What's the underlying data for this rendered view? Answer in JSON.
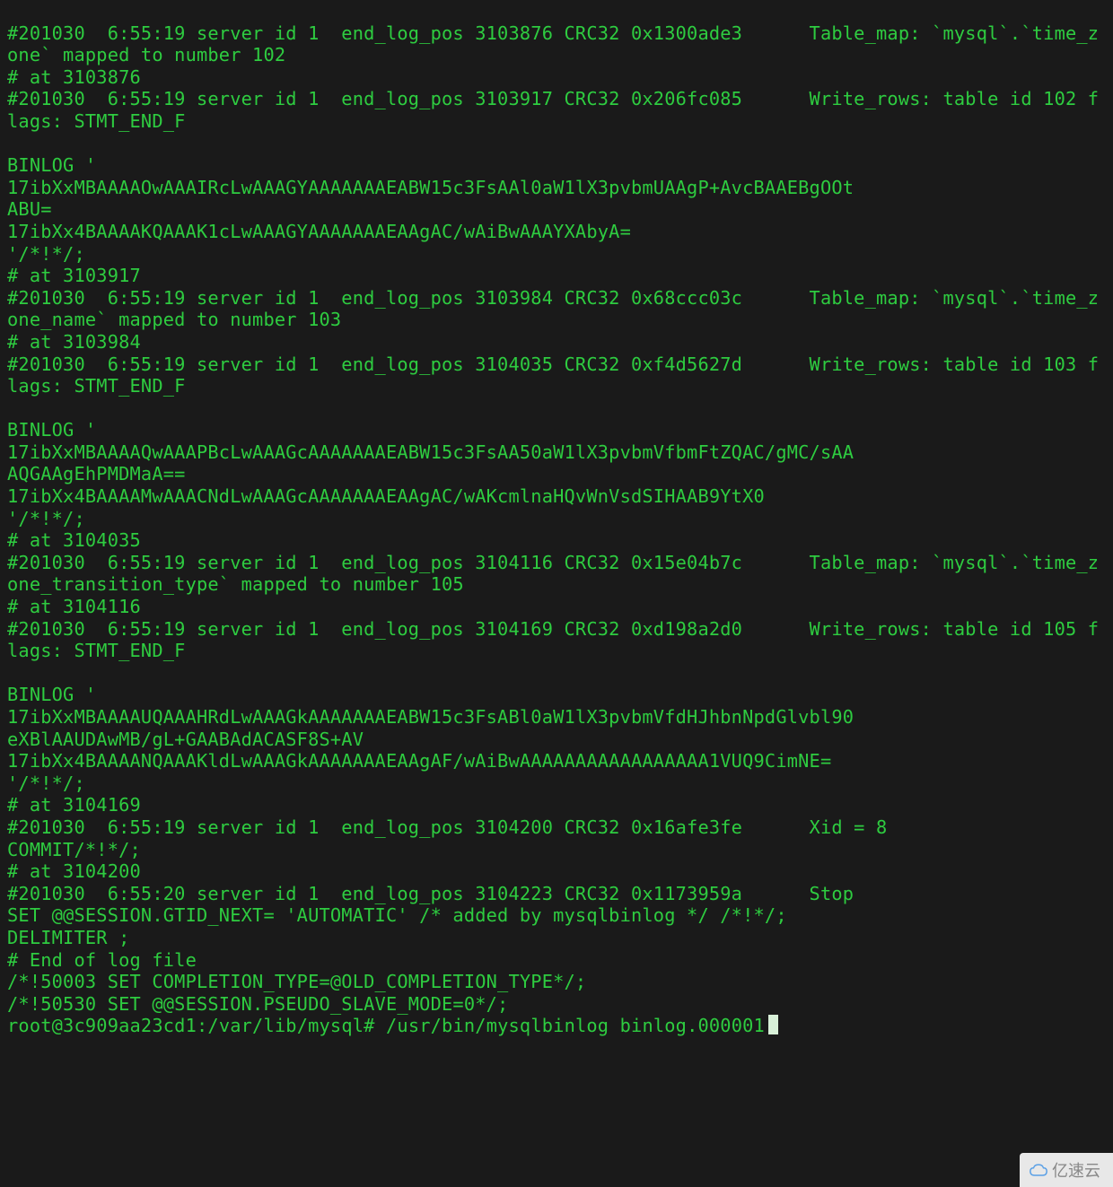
{
  "watermark": {
    "label": "亿速云"
  },
  "prompt": {
    "user_host": "root@3c909aa23cd1",
    "cwd": "/var/lib/mysql",
    "symbol": "#",
    "command": "/usr/bin/mysqlbinlog binlog.000001"
  },
  "lines": [
    "#201030  6:55:19 server id 1  end_log_pos 3103876 CRC32 0x1300ade3      Table_map: `mysql`.`time_zone` mapped to number 102",
    "# at 3103876",
    "#201030  6:55:19 server id 1  end_log_pos 3103917 CRC32 0x206fc085      Write_rows: table id 102 flags: STMT_END_F",
    "",
    "BINLOG '",
    "17ibXxMBAAAAOwAAAIRcLwAAAGYAAAAAAAEABW15c3FsAAl0aW1lX3pvbmUAAgP+AvcBAAEBgOOt",
    "ABU=",
    "17ibXx4BAAAAKQAAAK1cLwAAAGYAAAAAAAEAAgAC/wAiBwAAAYXAbyA=",
    "'/*!*/;",
    "# at 3103917",
    "#201030  6:55:19 server id 1  end_log_pos 3103984 CRC32 0x68ccc03c      Table_map: `mysql`.`time_zone_name` mapped to number 103",
    "# at 3103984",
    "#201030  6:55:19 server id 1  end_log_pos 3104035 CRC32 0xf4d5627d      Write_rows: table id 103 flags: STMT_END_F",
    "",
    "BINLOG '",
    "17ibXxMBAAAAQwAAAPBcLwAAAGcAAAAAAAEABW15c3FsAA50aW1lX3pvbmVfbmFtZQAC/gMC/sAA",
    "AQGAAgEhPMDMaA==",
    "17ibXx4BAAAAMwAAACNdLwAAAGcAAAAAAAEAAgAC/wAKcmlnaHQvWnVsdSIHAAB9YtX0",
    "'/*!*/;",
    "# at 3104035",
    "#201030  6:55:19 server id 1  end_log_pos 3104116 CRC32 0x15e04b7c      Table_map: `mysql`.`time_zone_transition_type` mapped to number 105",
    "# at 3104116",
    "#201030  6:55:19 server id 1  end_log_pos 3104169 CRC32 0xd198a2d0      Write_rows: table id 105 flags: STMT_END_F",
    "",
    "BINLOG '",
    "17ibXxMBAAAAUQAAAHRdLwAAAGkAAAAAAAEABW15c3FsABl0aW1lX3pvbmVfdHJhbnNpdGlvbl90",
    "eXBlAAUDAwMB/gL+GAABAdACASF8S+AV",
    "17ibXx4BAAAANQAAAKldLwAAAGkAAAAAAAEAAgAF/wAiBwAAAAAAAAAAAAAAAAA1VUQ9CimNE=",
    "'/*!*/;",
    "# at 3104169",
    "#201030  6:55:19 server id 1  end_log_pos 3104200 CRC32 0x16afe3fe      Xid = 8",
    "COMMIT/*!*/;",
    "# at 3104200",
    "#201030  6:55:20 server id 1  end_log_pos 3104223 CRC32 0x1173959a      Stop",
    "SET @@SESSION.GTID_NEXT= 'AUTOMATIC' /* added by mysqlbinlog */ /*!*/;",
    "DELIMITER ;",
    "# End of log file",
    "/*!50003 SET COMPLETION_TYPE=@OLD_COMPLETION_TYPE*/;",
    "/*!50530 SET @@SESSION.PSEUDO_SLAVE_MODE=0*/;"
  ]
}
